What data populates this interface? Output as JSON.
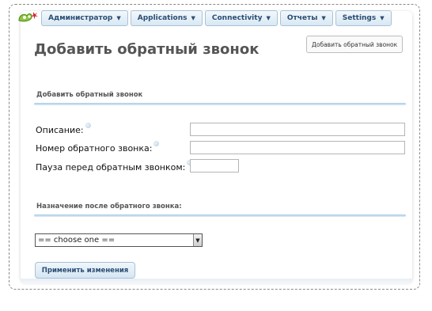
{
  "menu": {
    "items": [
      {
        "label": "Администратор"
      },
      {
        "label": "Applications"
      },
      {
        "label": "Connectivity"
      },
      {
        "label": "Отчеты"
      },
      {
        "label": "Settings"
      }
    ]
  },
  "page": {
    "title": "Добавить обратный звонок",
    "top_button": "Добавить обратный звонок"
  },
  "section1": {
    "title": "Добавить обратный звонок",
    "fields": [
      {
        "label": "Описание:",
        "value": ""
      },
      {
        "label": "Номер обратного звонка:",
        "value": ""
      },
      {
        "label": "Пауза перед обратным звонком:",
        "value": ""
      }
    ]
  },
  "section2": {
    "title": "Назначение после обратного звонка:",
    "select": {
      "selected": "== choose one =="
    }
  },
  "actions": {
    "apply_label": "Применить изменения"
  },
  "colors": {
    "menu_text": "#2b4d73",
    "menu_border": "#a7c2d8",
    "section_line": "#a9cbe5"
  }
}
